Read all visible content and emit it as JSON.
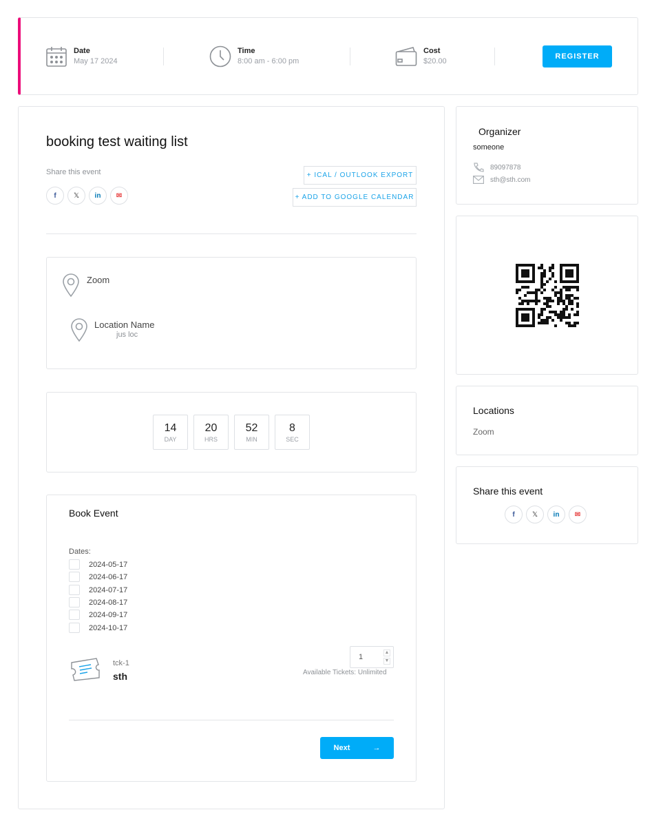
{
  "topbar": {
    "date_label": "Date",
    "date_value": "May 17 2024",
    "time_label": "Time",
    "time_value": "8:00 am - 6:00 pm",
    "cost_label": "Cost",
    "cost_value": "$20.00",
    "register_label": "REGISTER"
  },
  "event": {
    "title": "booking test waiting list",
    "share_label": "Share this event",
    "ical_label": "+ ICAL / OUTLOOK EXPORT",
    "google_label": "+ ADD TO GOOGLE CALENDAR"
  },
  "locations_box": {
    "primary": "Zoom",
    "secondary_name": "Location Name",
    "secondary_sub": "jus loc"
  },
  "countdown": [
    {
      "value": "14",
      "unit": "DAY"
    },
    {
      "value": "20",
      "unit": "HRS"
    },
    {
      "value": "52",
      "unit": "MIN"
    },
    {
      "value": "8",
      "unit": "SEC"
    }
  ],
  "booking": {
    "title": "Book Event",
    "dates_label": "Dates:",
    "dates": [
      "2024-05-17",
      "2024-06-17",
      "2024-07-17",
      "2024-08-17",
      "2024-09-17",
      "2024-10-17"
    ],
    "ticket_name": "tck-1",
    "ticket_price": "sth",
    "quantity": "1",
    "available": "Available Tickets: Unlimited",
    "next_label": "Next"
  },
  "organizer": {
    "heading": "Organizer",
    "name": "someone",
    "phone": "89097878",
    "email": "sth@sth.com"
  },
  "sidebar_locations": {
    "heading": "Locations",
    "item": "Zoom"
  },
  "sidebar_share": {
    "heading": "Share this event"
  },
  "social_icons": {
    "fb": "f",
    "x": "𝕏",
    "li": "in",
    "em": "✉"
  },
  "colors": {
    "accent": "#00acf8",
    "stripe": "#ec0d7a"
  }
}
